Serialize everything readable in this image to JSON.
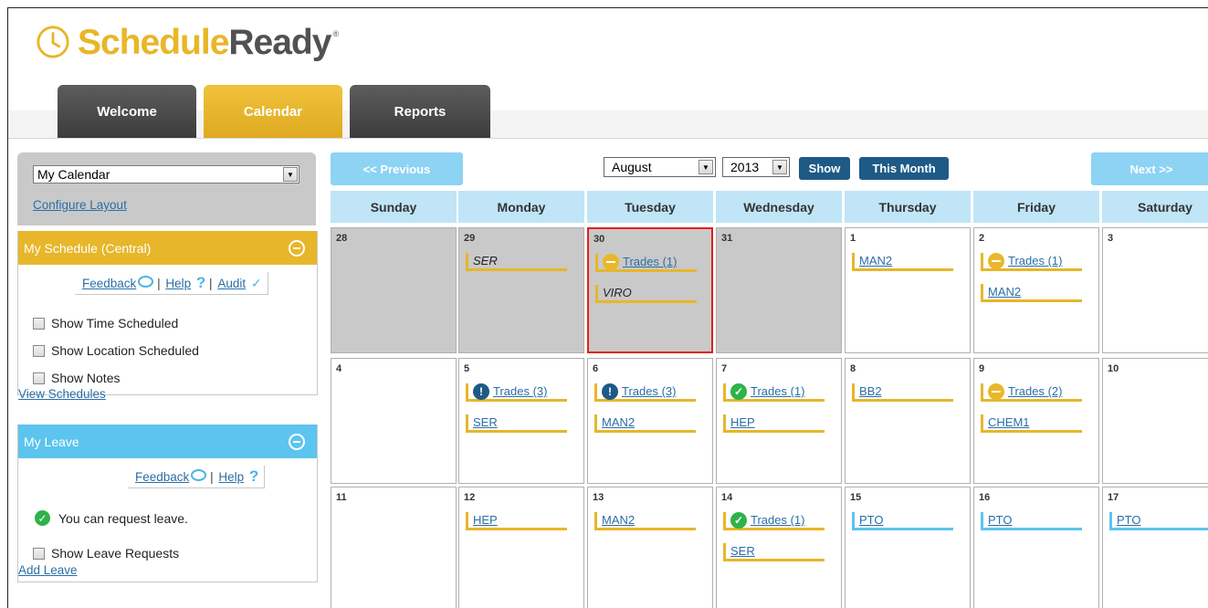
{
  "brand": {
    "name_part1": "Schedule",
    "name_part2": "Ready",
    "reg": "®",
    "yellow": "#e8b628",
    "gray": "#515151"
  },
  "tabs": [
    {
      "label": "Welcome",
      "active": false
    },
    {
      "label": "Calendar",
      "active": true
    },
    {
      "label": "Reports",
      "active": false
    }
  ],
  "sidebar": {
    "calendar_select": "My Calendar",
    "configure_link": "Configure Layout",
    "schedule_panel": {
      "title": "My Schedule (Central)",
      "feedback": "Feedback",
      "sep": "|",
      "help": "Help",
      "audit": "Audit",
      "options": [
        "Show Time Scheduled",
        "Show Location Scheduled",
        "Show Notes"
      ],
      "view_link": "View Schedules"
    },
    "leave_panel": {
      "title": "My Leave",
      "feedback": "Feedback",
      "sep": "|",
      "help": "Help",
      "status": "You can request leave.",
      "option": "Show Leave Requests",
      "add_link": "Add Leave"
    }
  },
  "toolbar": {
    "previous": "<< Previous",
    "next": "Next >>",
    "month": "August",
    "year": "2013",
    "show": "Show",
    "this_month": "This Month"
  },
  "calendar": {
    "days": [
      "Sunday",
      "Monday",
      "Tuesday",
      "Wednesday",
      "Thursday",
      "Friday",
      "Saturday"
    ],
    "weeks": [
      [
        {
          "day": "28",
          "gray": true,
          "events": []
        },
        {
          "day": "29",
          "gray": true,
          "events": [
            {
              "text": "SER",
              "kind": "plain"
            }
          ]
        },
        {
          "day": "30",
          "gray": true,
          "today": true,
          "events": [
            {
              "text": "Trades (1)",
              "kind": "link",
              "icon": "pending"
            },
            {
              "text": "VIRO",
              "kind": "plain"
            }
          ]
        },
        {
          "day": "31",
          "gray": true,
          "events": []
        },
        {
          "day": "1",
          "events": [
            {
              "text": "MAN2",
              "kind": "link"
            }
          ]
        },
        {
          "day": "2",
          "events": [
            {
              "text": "Trades (1)",
              "kind": "link",
              "icon": "pending"
            },
            {
              "text": "MAN2",
              "kind": "link"
            }
          ]
        },
        {
          "day": "3",
          "events": []
        }
      ],
      [
        {
          "day": "4",
          "events": []
        },
        {
          "day": "5",
          "events": [
            {
              "text": "Trades (3)",
              "kind": "link",
              "icon": "alert"
            },
            {
              "text": "SER",
              "kind": "link"
            }
          ]
        },
        {
          "day": "6",
          "events": [
            {
              "text": "Trades (3)",
              "kind": "link",
              "icon": "alert"
            },
            {
              "text": "MAN2",
              "kind": "link"
            }
          ]
        },
        {
          "day": "7",
          "events": [
            {
              "text": "Trades (1)",
              "kind": "link",
              "icon": "ok"
            },
            {
              "text": "HEP",
              "kind": "link"
            }
          ]
        },
        {
          "day": "8",
          "events": [
            {
              "text": "BB2",
              "kind": "link"
            }
          ]
        },
        {
          "day": "9",
          "events": [
            {
              "text": "Trades (2)",
              "kind": "link",
              "icon": "pending"
            },
            {
              "text": "CHEM1",
              "kind": "link"
            }
          ]
        },
        {
          "day": "10",
          "events": []
        }
      ],
      [
        {
          "day": "11",
          "events": []
        },
        {
          "day": "12",
          "events": [
            {
              "text": "HEP",
              "kind": "link"
            }
          ]
        },
        {
          "day": "13",
          "events": [
            {
              "text": "MAN2",
              "kind": "link"
            }
          ]
        },
        {
          "day": "14",
          "events": [
            {
              "text": "Trades (1)",
              "kind": "link",
              "icon": "ok"
            },
            {
              "text": "SER",
              "kind": "link"
            }
          ]
        },
        {
          "day": "15",
          "events": [
            {
              "text": "PTO",
              "kind": "link",
              "color": "blue"
            }
          ]
        },
        {
          "day": "16",
          "events": [
            {
              "text": "PTO",
              "kind": "link",
              "color": "blue"
            }
          ]
        },
        {
          "day": "17",
          "events": [
            {
              "text": "PTO",
              "kind": "link",
              "color": "blue"
            }
          ]
        }
      ]
    ]
  }
}
